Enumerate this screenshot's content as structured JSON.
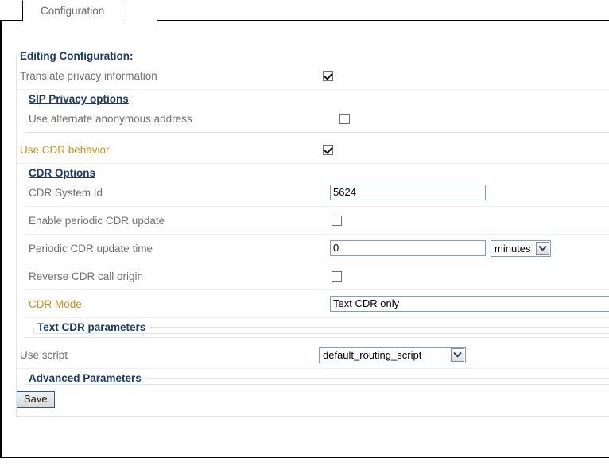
{
  "tabs": [
    {
      "label": "Configuration",
      "active": true
    }
  ],
  "outer_fieldset": {
    "legend": "Editing Configuration:"
  },
  "rows": {
    "translate_privacy": {
      "label": "Translate privacy information",
      "checkbox_state": "checked"
    },
    "use_alternate_anonymous": {
      "label": "Use alternate anonymous address",
      "checkbox_state": "unchecked"
    },
    "use_cdr_behavior": {
      "label": "Use CDR behavior",
      "checkbox_state": "checked"
    },
    "cdr_system_id": {
      "label": "CDR System Id",
      "value": "5624"
    },
    "enable_periodic_cdr_update": {
      "label": "Enable periodic CDR update",
      "checkbox_state": "unchecked"
    },
    "periodic_cdr_update_time": {
      "label": "Periodic CDR update time",
      "value": "0",
      "unit_selected": "minutes"
    },
    "reverse_cdr_call_origin": {
      "label": "Reverse CDR call origin",
      "checkbox_state": "unchecked"
    },
    "cdr_mode": {
      "label": "CDR Mode",
      "selected": "Text CDR only"
    },
    "use_script": {
      "label": "Use script",
      "selected": "default_routing_script"
    }
  },
  "sections": {
    "sip_privacy_options": "SIP Privacy options",
    "cdr_options": "CDR Options",
    "text_cdr_parameters": "Text CDR parameters",
    "advanced_parameters": "Advanced Parameters"
  },
  "buttons": {
    "save": "Save"
  },
  "colors": {
    "legend_navy": "#1b3a66",
    "label_gray": "#70706f",
    "label_gold": "#c8921c",
    "input_border_blue": "#7b9ec4",
    "separator": "#f0f0f0",
    "fieldset_border": "#e2e2e2"
  }
}
